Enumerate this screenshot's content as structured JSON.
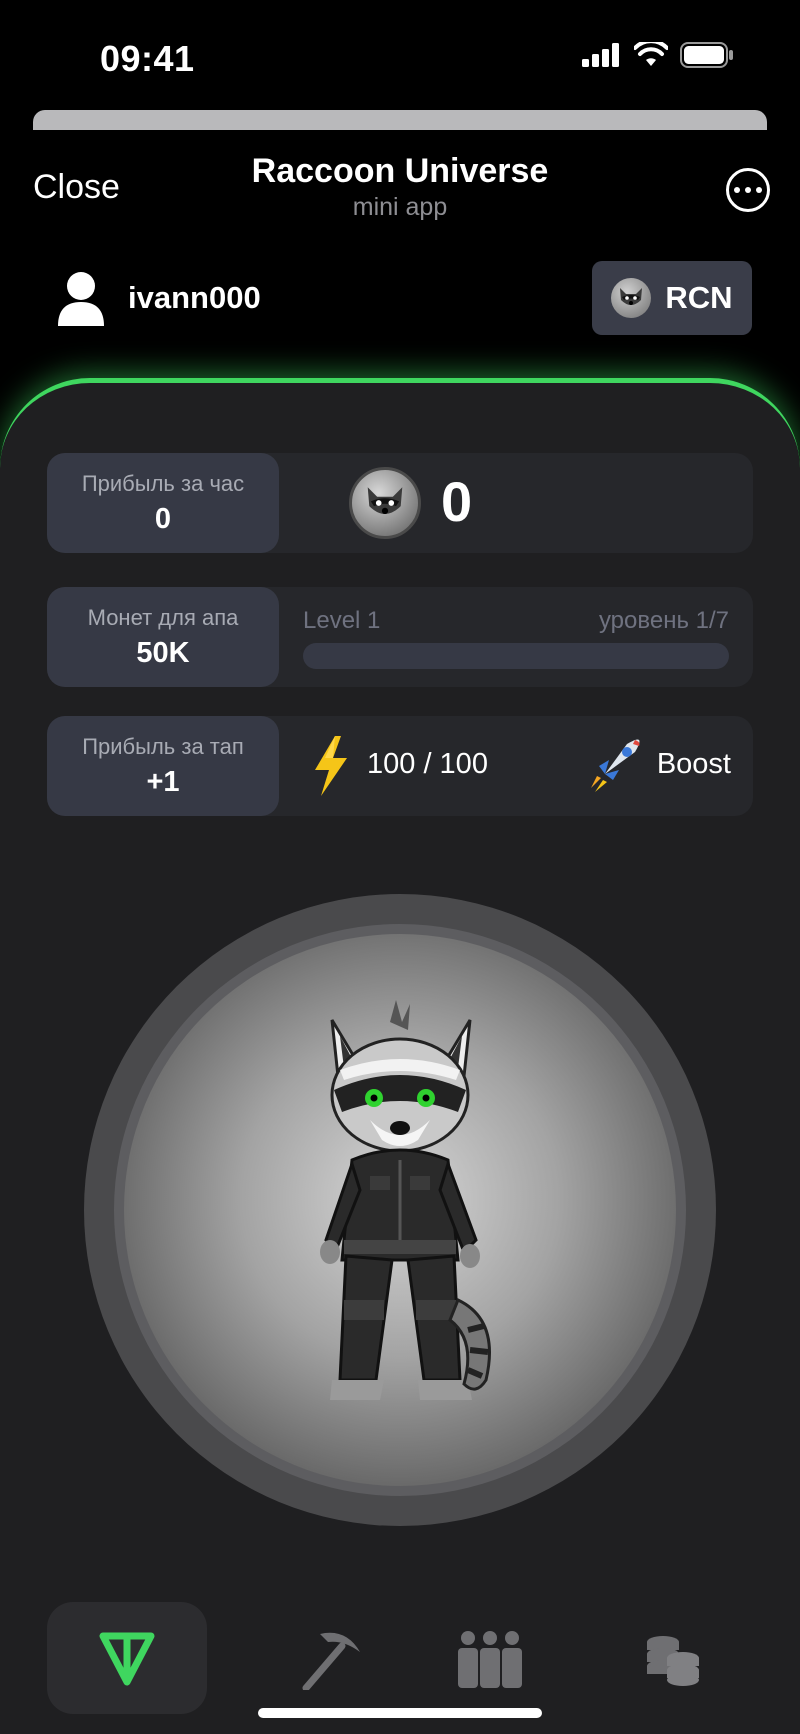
{
  "status_bar": {
    "time": "09:41"
  },
  "header": {
    "close_label": "Close",
    "title": "Raccoon Universe",
    "subtitle": "mini app",
    "more_icon": "more-horizontal-icon"
  },
  "user": {
    "name": "ivann000",
    "avatar_icon": "user-icon"
  },
  "currency_button": {
    "label": "RCN",
    "icon": "raccoon-coin-icon"
  },
  "colors": {
    "accent": "#3fd65f",
    "panel": "#1f1f21",
    "card": "#26272b",
    "label_box": "#363945"
  },
  "stats": {
    "hourly": {
      "label": "Прибыль за час",
      "value": "0"
    },
    "balance": {
      "value": "0",
      "icon": "raccoon-coin-icon"
    },
    "coins_to_level": {
      "label": "Монет для апа",
      "value": "50K"
    },
    "level": {
      "name": "Level 1",
      "progress_text": "уровень 1/7",
      "progress": 0
    },
    "per_tap": {
      "label": "Прибыль за тап",
      "value": "+1"
    },
    "energy": {
      "text": "100 / 100",
      "icon": "lightning-icon"
    },
    "boost": {
      "label": "Boost",
      "icon": "rocket-icon"
    }
  },
  "tap_target": {
    "image": "raccoon-character"
  },
  "bottom_nav": [
    {
      "name": "tap",
      "icon": "ton-logo-icon",
      "active": true
    },
    {
      "name": "mine",
      "icon": "pickaxe-icon",
      "active": false
    },
    {
      "name": "friends",
      "icon": "people-icon",
      "active": false
    },
    {
      "name": "earn",
      "icon": "coins-icon",
      "active": false
    }
  ]
}
